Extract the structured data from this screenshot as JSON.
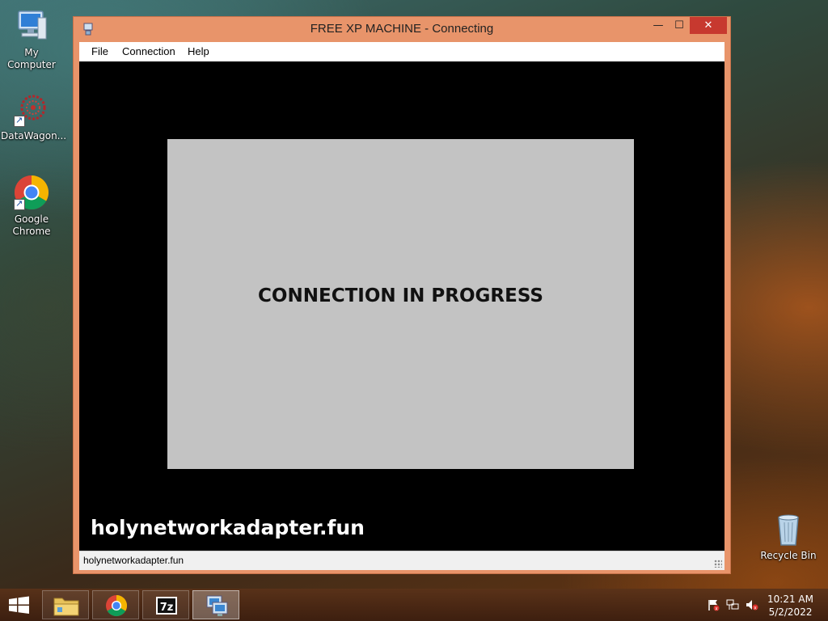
{
  "desktop": {
    "icons": [
      {
        "label": "My Computer"
      },
      {
        "label": "DataWagon..."
      },
      {
        "label": "Google\nChrome"
      },
      {
        "label": "Recycle Bin"
      }
    ]
  },
  "window": {
    "title": "FREE XP MACHINE - Connecting",
    "menu": [
      "File",
      "Connection",
      "Help"
    ],
    "content": {
      "message": "CONNECTION IN PROGRESS",
      "watermark": "holynetworkadapter.fun"
    },
    "status": "holynetworkadapter.fun"
  },
  "taskbar": {
    "apps": [
      "file-explorer",
      "chrome",
      "7zip",
      "remote-desktop"
    ],
    "clock": {
      "time": "10:21 AM",
      "date": "5/2/2022"
    }
  },
  "colors": {
    "window_frame": "#e8946a",
    "close_button": "#c7392f",
    "remote_background": "#000000",
    "status_panel": "#c3c3c3"
  }
}
